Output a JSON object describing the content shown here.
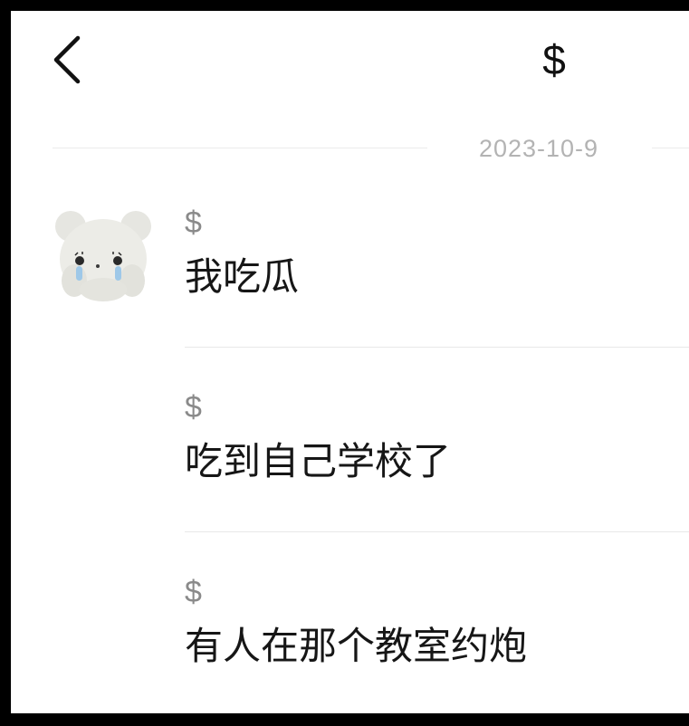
{
  "header": {
    "back_icon": "chevron-left-icon",
    "title": "$"
  },
  "date_separator": "2023-10-9",
  "avatar": {
    "icon": "crying-bear-avatar"
  },
  "messages": [
    {
      "sender": "$",
      "text": "我吃瓜"
    },
    {
      "sender": "$",
      "text": "吃到自己学校了"
    },
    {
      "sender": "$",
      "text": "有人在那个教室约炮"
    }
  ],
  "colors": {
    "frame": "#000000",
    "background": "#ffffff",
    "title": "#111111",
    "date_text": "#b3b3b3",
    "sender_text": "#8a8a8a",
    "message_text": "#161616",
    "divider": "#e8e8e8",
    "tear": "#9ec8e8"
  }
}
